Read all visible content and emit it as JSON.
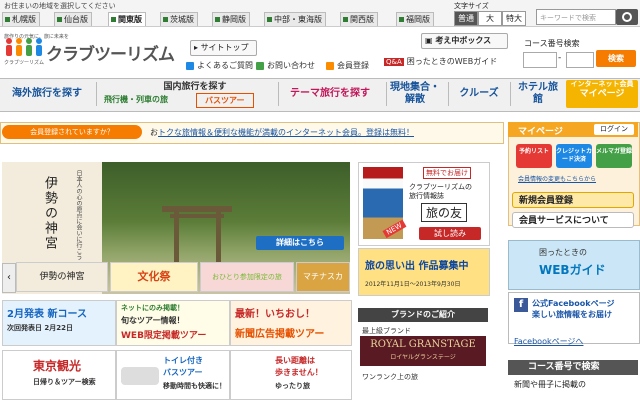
{
  "region_bar": {
    "notice": "お住まいの地域を選択してください",
    "tabs": [
      "札幌版",
      "仙台版",
      "関東版",
      "茨城版",
      "静岡版",
      "中部・東海版",
      "関西版",
      "福岡版"
    ],
    "active_tab": "関東版",
    "font_size_label": "文字サイズ",
    "font_sizes": [
      "普通",
      "大",
      "特大"
    ],
    "search_placeholder": "キーワードで検索"
  },
  "header": {
    "logo_tagline": "旅作りの元気に、旅に未来を",
    "logo_sub": "クラブツーリズム",
    "logo_name": "クラブツーリズム",
    "links": {
      "site_top": "サイトトップ",
      "faq": "よくあるご質問",
      "contact": "お問い合わせ",
      "member_reg": "会員登録",
      "considering_box": "考え中ボックス",
      "qa_badge": "Q&A",
      "web_guide": "困ったときのWEBガイド"
    },
    "course_search": {
      "label": "コース番号検索",
      "dash": "-",
      "button": "検索"
    }
  },
  "nav": {
    "overseas": "海外旅行を探す",
    "domestic_title": "国内旅行を探す",
    "domestic_sub1": "飛行機・列車の旅",
    "domestic_sub2": "バスツアー",
    "theme": "テーマ旅行を探す",
    "local": "現地集合・解散",
    "cruise": "クルーズ",
    "hotel": "ホテル旅館",
    "internet_only": "インターネット会員",
    "mypage": "マイページ"
  },
  "member_banner": {
    "pill": "会員登録されていますか？",
    "text_pre": "お",
    "text_main": "トクな旅情報＆便利な機能が満載のインターネット会員。登録は無料！"
  },
  "hero": {
    "title": "伊勢の神宮",
    "caption": "日本人の心の原点に会いに行こう",
    "detail_button": "詳細はこちら",
    "thumbs": [
      "伊勢の神宮",
      "文化祭",
      "おひとり参加限定の旅",
      "マチナスカ"
    ]
  },
  "grid_banners": [
    {
      "l1": "2月発表 新コース",
      "l2": "次回発表日 2月22日"
    },
    {
      "l1": "ネットにのみ掲載！",
      "l2": "旬なツアー情報！",
      "l3": "WEB限定掲載ツアー"
    },
    {
      "l1": "最新！いちおし！",
      "l2": "新聞広告掲載ツアー"
    },
    {
      "l1": "東京観光",
      "l2": "日帰り＆ツアー検索"
    },
    {
      "l1": "トイレ付き",
      "l2": "バスツアー",
      "l3": "移動時間も快適に！"
    },
    {
      "l1": "長い距離は",
      "l2": "歩きません！",
      "l3": "ゆったり旅"
    }
  ],
  "middle": {
    "friend_top": "無料でお届け",
    "friend_line1": "クラブツーリズムの",
    "friend_line2": "旅行情報誌",
    "friend_big": "旅の友",
    "friend_try": "試し読み",
    "friend_new": "NEW",
    "memories_title": "旅の思い出 作品募集中",
    "memories_dates": "2012年11月1日～2013年9月30日",
    "brand_header": "ブランドのご紹介",
    "brand_label1": "最上級ブランド",
    "brand_royal": "ROYAL GRANSTAGE",
    "brand_royal_jp": "ロイヤルグランステージ",
    "brand_label2": "ワンランク上の旅"
  },
  "right": {
    "mypage_title": "マイページ",
    "login": "ログイン",
    "btns": [
      "予約リスト",
      "クレジットカード決済",
      "メルマガ登録"
    ],
    "info_change": "会員情報の変更もこちらから",
    "register": "新規会員登録",
    "member_service": "会員サービスについて",
    "web_guide_title": "困ったときの",
    "web_guide_big": "WEBガイド",
    "fb_line1": "公式Facebookページ",
    "fb_line2": "楽しい旅情報をお届け",
    "fb_link": "Facebookページへ",
    "course_title": "コース番号で検索",
    "course_body": "新聞や冊子に掲載の"
  },
  "colors": {
    "brand_blue": "#17549b",
    "accent_orange": "#f57c00",
    "mypage_yellow": "#f5b400",
    "facebook": "#3b5998"
  }
}
